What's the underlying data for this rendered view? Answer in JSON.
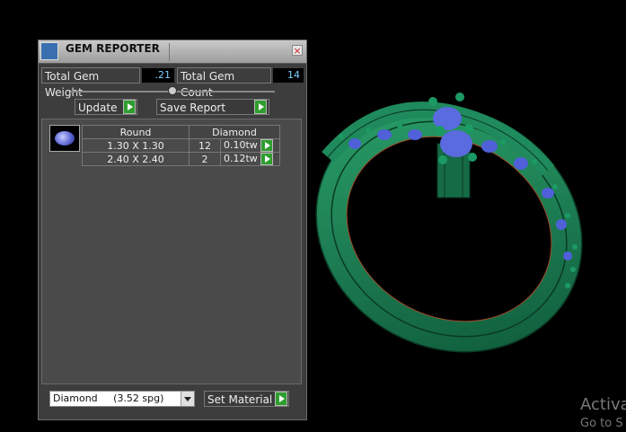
{
  "window": {
    "title": "GEM REPORTER"
  },
  "stats": {
    "weight_label": "Total Gem Weight",
    "weight_value": ".21",
    "count_label": "Total Gem Count",
    "count_value": "14"
  },
  "buttons": {
    "update": "Update",
    "save_report": "Save Report",
    "set_material": "Set Material"
  },
  "gem_table": {
    "shape": "Round",
    "type": "Diamond",
    "rows": [
      {
        "size": "1.30 X 1.30",
        "count": "12",
        "weight": "0.10tw"
      },
      {
        "size": "2.40 X 2.40",
        "count": "2",
        "weight": "0.12tw"
      }
    ]
  },
  "material": {
    "selected": "Diamond     (3.52 spg)"
  },
  "watermark": {
    "line1": "Activa",
    "line2": "Go to S"
  },
  "colors": {
    "ring_green": "#1f8a5b",
    "gem_blue": "#5a6be0",
    "accent_green": "#2e9e2e"
  },
  "icons": {
    "title_icon": "gem-reporter-icon",
    "close": "close-icon",
    "go": "play-arrow-icon"
  }
}
